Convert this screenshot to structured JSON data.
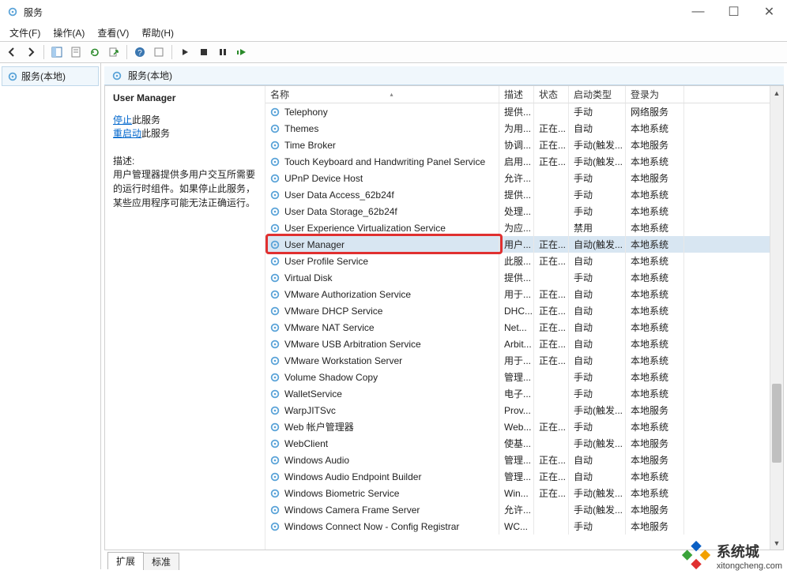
{
  "app": {
    "title": "服务"
  },
  "menu": {
    "file": "文件(F)",
    "action": "操作(A)",
    "view": "查看(V)",
    "help": "帮助(H)"
  },
  "tree": {
    "root": "服务(本地)"
  },
  "pane_header": "服务(本地)",
  "detail": {
    "title": "User Manager",
    "stop_link": "停止",
    "stop_suffix": "此服务",
    "restart_link": "重启动",
    "restart_suffix": "此服务",
    "desc_label": "描述:",
    "desc_text": "用户管理器提供多用户交互所需要的运行时组件。如果停止此服务，某些应用程序可能无法正确运行。"
  },
  "columns": {
    "name": "名称",
    "desc": "描述",
    "status": "状态",
    "startup": "启动类型",
    "logon": "登录为"
  },
  "services": [
    {
      "name": "Telephony",
      "desc": "提供...",
      "status": "",
      "startup": "手动",
      "logon": "网络服务"
    },
    {
      "name": "Themes",
      "desc": "为用...",
      "status": "正在...",
      "startup": "自动",
      "logon": "本地系统"
    },
    {
      "name": "Time Broker",
      "desc": "协调...",
      "status": "正在...",
      "startup": "手动(触发...",
      "logon": "本地服务"
    },
    {
      "name": "Touch Keyboard and Handwriting Panel Service",
      "desc": "启用...",
      "status": "正在...",
      "startup": "手动(触发...",
      "logon": "本地系统"
    },
    {
      "name": "UPnP Device Host",
      "desc": "允许...",
      "status": "",
      "startup": "手动",
      "logon": "本地服务"
    },
    {
      "name": "User Data Access_62b24f",
      "desc": "提供...",
      "status": "",
      "startup": "手动",
      "logon": "本地系统"
    },
    {
      "name": "User Data Storage_62b24f",
      "desc": "处理...",
      "status": "",
      "startup": "手动",
      "logon": "本地系统"
    },
    {
      "name": "User Experience Virtualization Service",
      "desc": "为应...",
      "status": "",
      "startup": "禁用",
      "logon": "本地系统"
    },
    {
      "name": "User Manager",
      "desc": "用户...",
      "status": "正在...",
      "startup": "自动(触发...",
      "logon": "本地系统",
      "selected": true
    },
    {
      "name": "User Profile Service",
      "desc": "此服...",
      "status": "正在...",
      "startup": "自动",
      "logon": "本地系统"
    },
    {
      "name": "Virtual Disk",
      "desc": "提供...",
      "status": "",
      "startup": "手动",
      "logon": "本地系统"
    },
    {
      "name": "VMware Authorization Service",
      "desc": "用于...",
      "status": "正在...",
      "startup": "自动",
      "logon": "本地系统"
    },
    {
      "name": "VMware DHCP Service",
      "desc": "DHC...",
      "status": "正在...",
      "startup": "自动",
      "logon": "本地系统"
    },
    {
      "name": "VMware NAT Service",
      "desc": "Net...",
      "status": "正在...",
      "startup": "自动",
      "logon": "本地系统"
    },
    {
      "name": "VMware USB Arbitration Service",
      "desc": "Arbit...",
      "status": "正在...",
      "startup": "自动",
      "logon": "本地系统"
    },
    {
      "name": "VMware Workstation Server",
      "desc": "用于...",
      "status": "正在...",
      "startup": "自动",
      "logon": "本地系统"
    },
    {
      "name": "Volume Shadow Copy",
      "desc": "管理...",
      "status": "",
      "startup": "手动",
      "logon": "本地系统"
    },
    {
      "name": "WalletService",
      "desc": "电子...",
      "status": "",
      "startup": "手动",
      "logon": "本地系统"
    },
    {
      "name": "WarpJITSvc",
      "desc": "Prov...",
      "status": "",
      "startup": "手动(触发...",
      "logon": "本地服务"
    },
    {
      "name": "Web 帐户管理器",
      "desc": "Web...",
      "status": "正在...",
      "startup": "手动",
      "logon": "本地系统"
    },
    {
      "name": "WebClient",
      "desc": "使基...",
      "status": "",
      "startup": "手动(触发...",
      "logon": "本地服务"
    },
    {
      "name": "Windows Audio",
      "desc": "管理...",
      "status": "正在...",
      "startup": "自动",
      "logon": "本地服务"
    },
    {
      "name": "Windows Audio Endpoint Builder",
      "desc": "管理...",
      "status": "正在...",
      "startup": "自动",
      "logon": "本地系统"
    },
    {
      "name": "Windows Biometric Service",
      "desc": "Win...",
      "status": "正在...",
      "startup": "手动(触发...",
      "logon": "本地系统"
    },
    {
      "name": "Windows Camera Frame Server",
      "desc": "允许...",
      "status": "",
      "startup": "手动(触发...",
      "logon": "本地服务"
    },
    {
      "name": "Windows Connect Now - Config Registrar",
      "desc": "WC...",
      "status": "",
      "startup": "手动",
      "logon": "本地服务"
    }
  ],
  "tabs": {
    "extended": "扩展",
    "standard": "标准"
  },
  "watermark": {
    "brand": "系统城",
    "url": "xitongcheng.com"
  }
}
